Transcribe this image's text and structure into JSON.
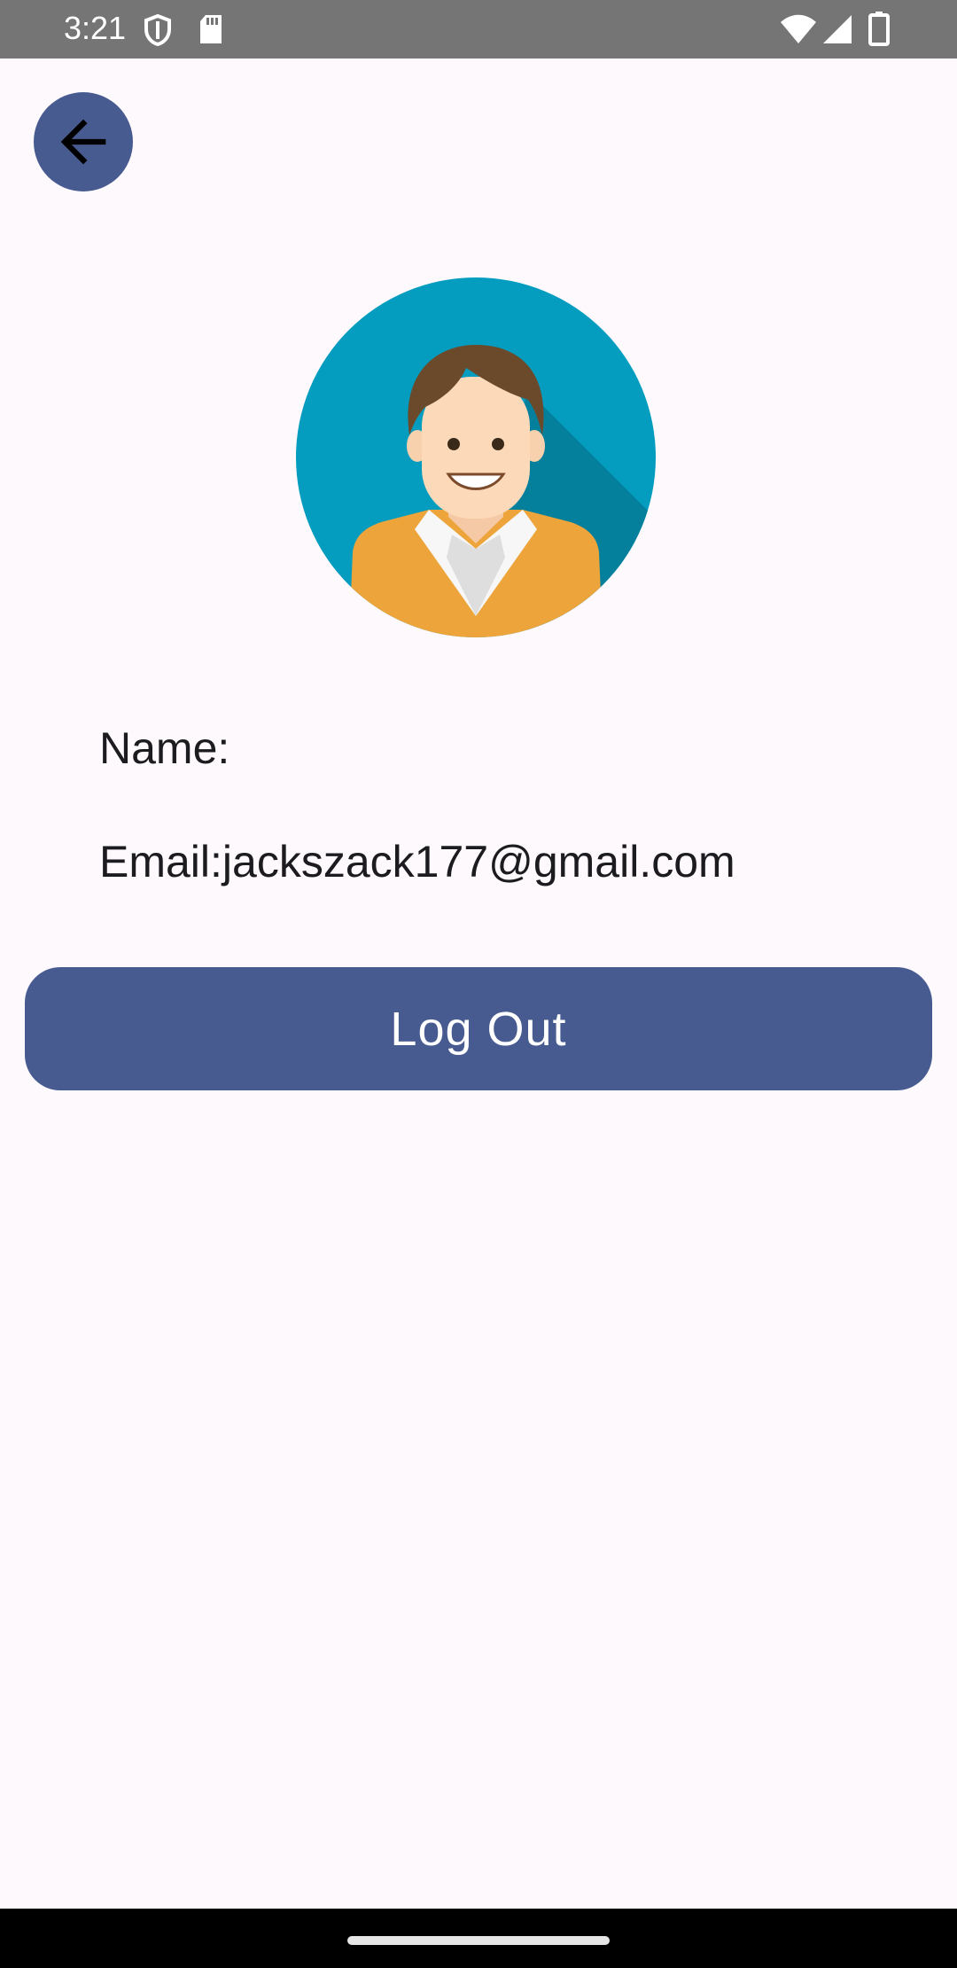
{
  "status_bar": {
    "time": "3:21",
    "icons": [
      "shield-icon",
      "sd-card-icon",
      "wifi-icon",
      "signal-icon",
      "battery-icon"
    ]
  },
  "header": {
    "back_icon": "arrow-back-icon"
  },
  "profile": {
    "avatar_icon": "user-avatar-illustration",
    "name_label": "Name:",
    "email_label": "Email:jackszack177@gmail.com"
  },
  "actions": {
    "logout_label": "Log Out"
  },
  "colors": {
    "accent": "#485b91",
    "background": "#fdf9fd",
    "status_bar": "#757575",
    "text": "#1c1b1f"
  }
}
